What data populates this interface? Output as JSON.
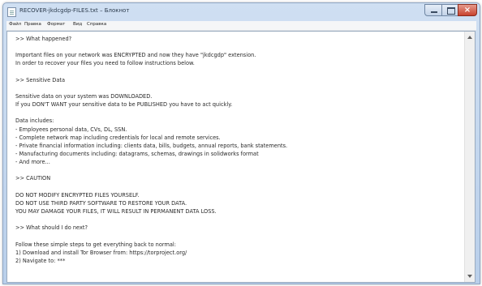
{
  "window": {
    "title": "RECOVER-jkdcgdp-FILES.txt – Блокнот",
    "controls": {
      "close_label": "×"
    }
  },
  "menu": {
    "items": [
      "Файл",
      "Правка",
      "Формат",
      "Вид",
      "Справка"
    ]
  },
  "document": {
    "lines": [
      ">> What happened?",
      "",
      "Important files on your network was ENCRYPTED and now they have \"jkdcgdp\" extension.",
      "In order to recover your files you need to follow instructions below.",
      "",
      ">> Sensitive Data",
      "",
      "Sensitive data on your system was DOWNLOADED.",
      "If you DON'T WANT your sensitive data to be PUBLISHED you have to act quickly.",
      "",
      "Data includes:",
      "- Employees personal data, CVs, DL, SSN.",
      "- Complete network map including credentials for local and remote services.",
      "- Private financial information including: clients data, bills, budgets, annual reports, bank statements.",
      "- Manufacturing documents including: datagrams, schemas, drawings in solidworks format",
      "- And more...",
      "",
      ">> CAUTION",
      "",
      "DO NOT MODIFY ENCRYPTED FILES YOURSELF.",
      "DO NOT USE THIRD PARTY SOFTWARE TO RESTORE YOUR DATA.",
      "YOU MAY DAMAGE YOUR FILES, IT WILL RESULT IN PERMANENT DATA LOSS.",
      "",
      ">> What should I do next?",
      "",
      "Follow these simple steps to get everything back to normal:",
      "1) Download and install Tor Browser from: https://torproject.org/",
      "2) Navigate to: ***"
    ]
  }
}
